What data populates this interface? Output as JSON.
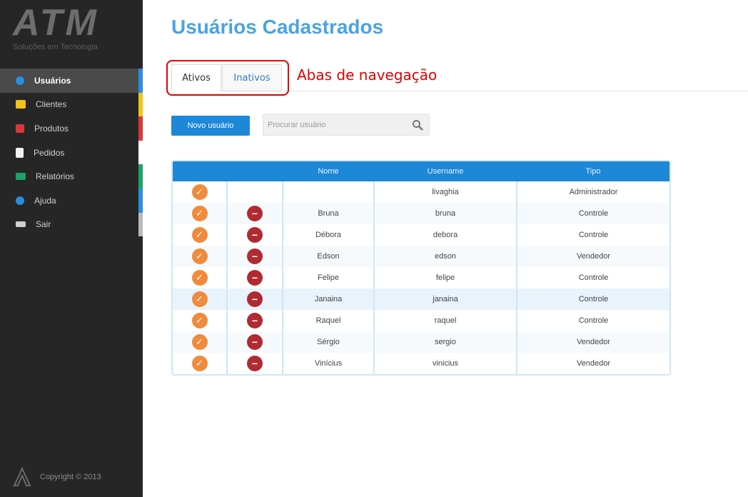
{
  "brand": {
    "mark": "ATM",
    "subtitle": "Soluções em Tecnologia"
  },
  "sidebar": {
    "items": [
      {
        "label": "Usuários",
        "icon": "users-icon",
        "color": "#2b8de0",
        "active": true
      },
      {
        "label": "Clientes",
        "icon": "envelope-icon",
        "color": "#f0c419"
      },
      {
        "label": "Produtos",
        "icon": "box-icon",
        "color": "#d9383a"
      },
      {
        "label": "Pedidos",
        "icon": "document-icon",
        "color": "#ffffff"
      },
      {
        "label": "Relatórios",
        "icon": "chart-icon",
        "color": "#1aa36b"
      },
      {
        "label": "Ajuda",
        "icon": "help-icon",
        "color": "#2b8de0"
      },
      {
        "label": "Sair",
        "icon": "exit-icon",
        "color": "#bbbbbb"
      }
    ],
    "copyright": "Copyright © 2013"
  },
  "page": {
    "title": "Usuários Cadastrados"
  },
  "tabs": {
    "active": "Ativos",
    "inactive": "Inativos"
  },
  "annotation": {
    "label": "Abas de navegação"
  },
  "toolbar": {
    "new_user_label": "Novo usuário",
    "search_placeholder": "Procurar usuário"
  },
  "table": {
    "headers": {
      "nome": "Nome",
      "username": "Username",
      "tipo": "Tipo"
    },
    "rows": [
      {
        "nome": "",
        "username": "livaghia",
        "tipo": "Administrador",
        "removable": false
      },
      {
        "nome": "Bruna",
        "username": "bruna",
        "tipo": "Controle",
        "removable": true
      },
      {
        "nome": "Débora",
        "username": "debora",
        "tipo": "Controle",
        "removable": true
      },
      {
        "nome": "Edson",
        "username": "edson",
        "tipo": "Vendedor",
        "removable": true
      },
      {
        "nome": "Felipe",
        "username": "felipe",
        "tipo": "Controle",
        "removable": true
      },
      {
        "nome": "Janaina",
        "username": "janaina",
        "tipo": "Controle",
        "removable": true,
        "highlight": true
      },
      {
        "nome": "Raquel",
        "username": "raquel",
        "tipo": "Controle",
        "removable": true
      },
      {
        "nome": "Sérgio",
        "username": "sergio",
        "tipo": "Vendedor",
        "removable": true
      },
      {
        "nome": "Vinícius",
        "username": "vinicius",
        "tipo": "Vendedor",
        "removable": true
      }
    ]
  },
  "colors": {
    "accent": "#1d87d8",
    "title": "#4aa3df",
    "sidebar_bg": "#262626",
    "edit": "#f08a3c",
    "remove": "#b02a32",
    "annotation": "#e00000"
  }
}
